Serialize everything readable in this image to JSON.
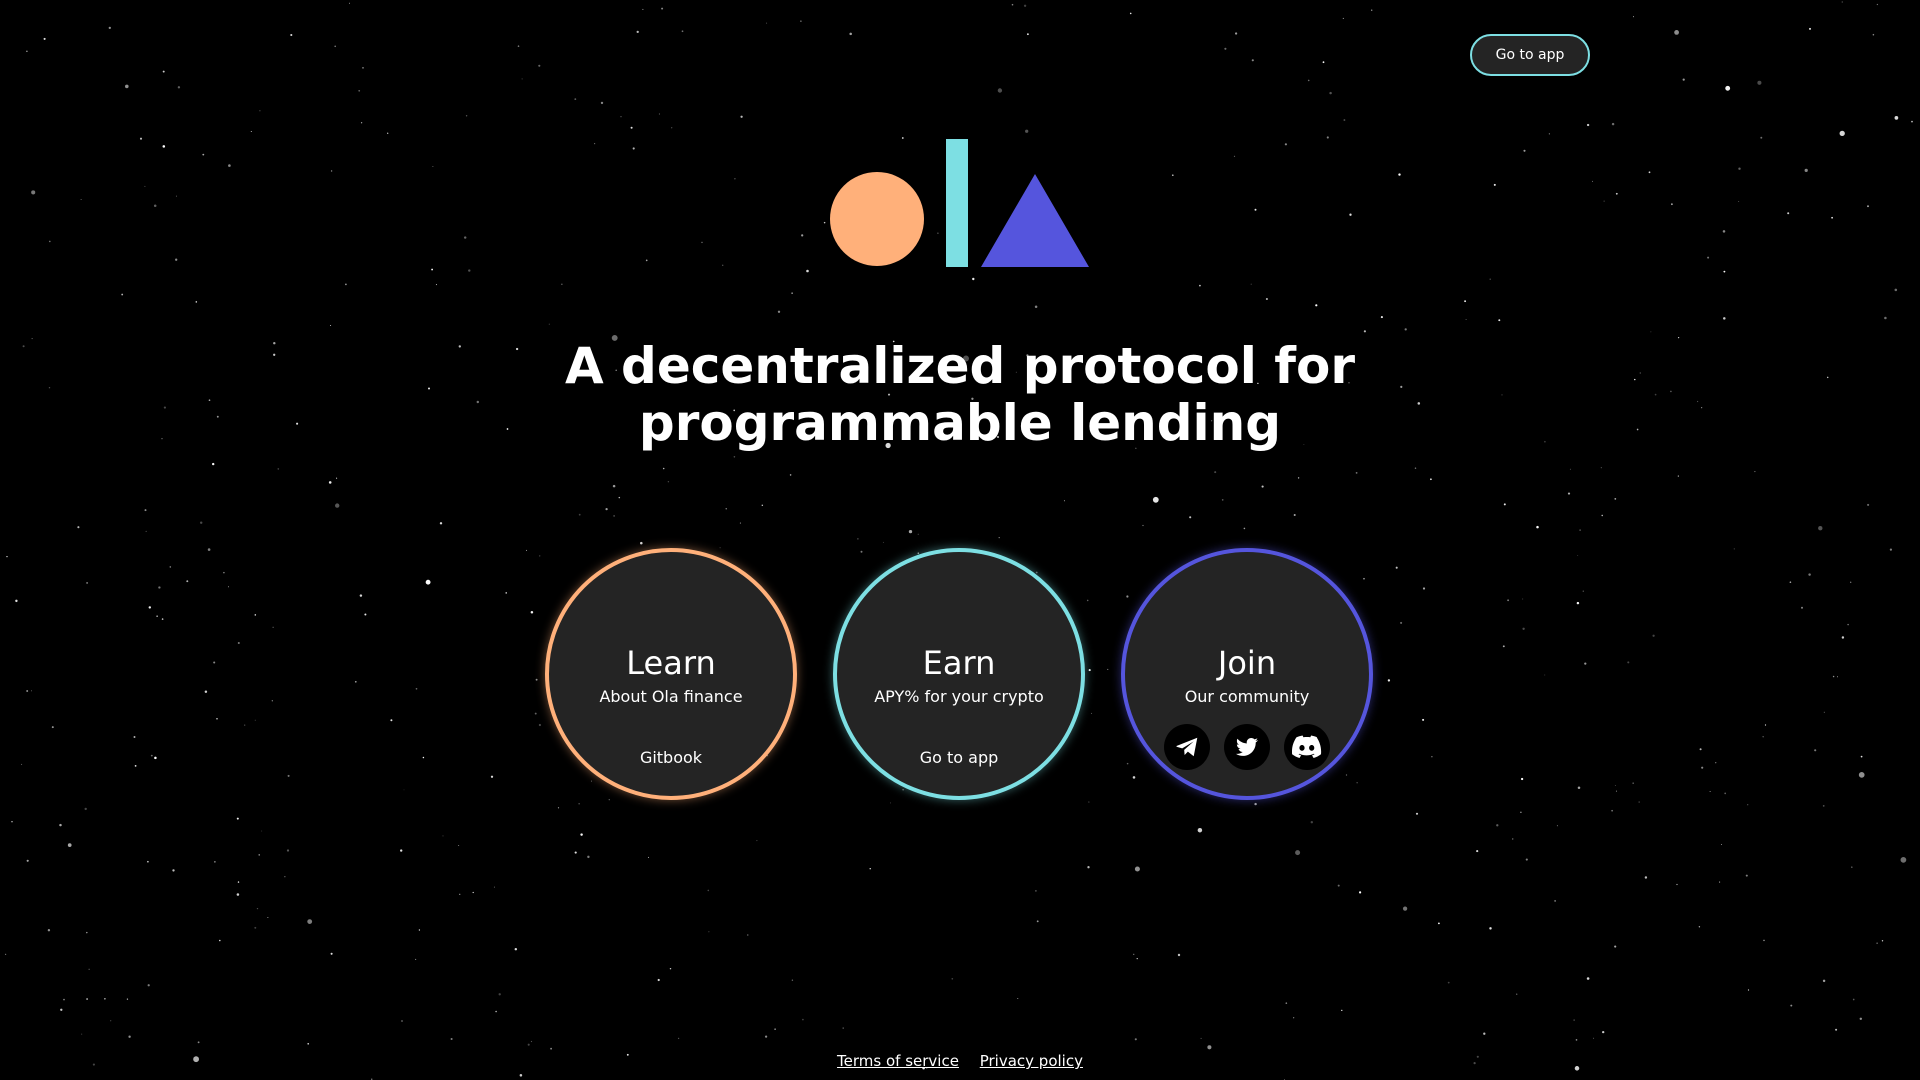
{
  "header": {
    "go_to_app_label": "Go to app"
  },
  "hero": {
    "headline_line1": "A decentralized protocol for",
    "headline_line2": "programmable lending"
  },
  "logo": {
    "circle_color": "#ffb07a",
    "bar_color": "#7ddfe3",
    "triangle_color": "#5555dd"
  },
  "cards": {
    "learn": {
      "title": "Learn",
      "subtitle": "About Ola finance",
      "link": "Gitbook",
      "ring_color": "#ffb07a"
    },
    "earn": {
      "title": "Earn",
      "subtitle": "APY% for your crypto",
      "link": "Go to app",
      "ring_color": "#7ddfe3"
    },
    "join": {
      "title": "Join",
      "subtitle": "Our community",
      "ring_color": "#5555dd",
      "social_icons": [
        "telegram-icon",
        "twitter-icon",
        "discord-icon"
      ]
    }
  },
  "footer": {
    "terms": "Terms of service",
    "privacy": "Privacy policy"
  }
}
